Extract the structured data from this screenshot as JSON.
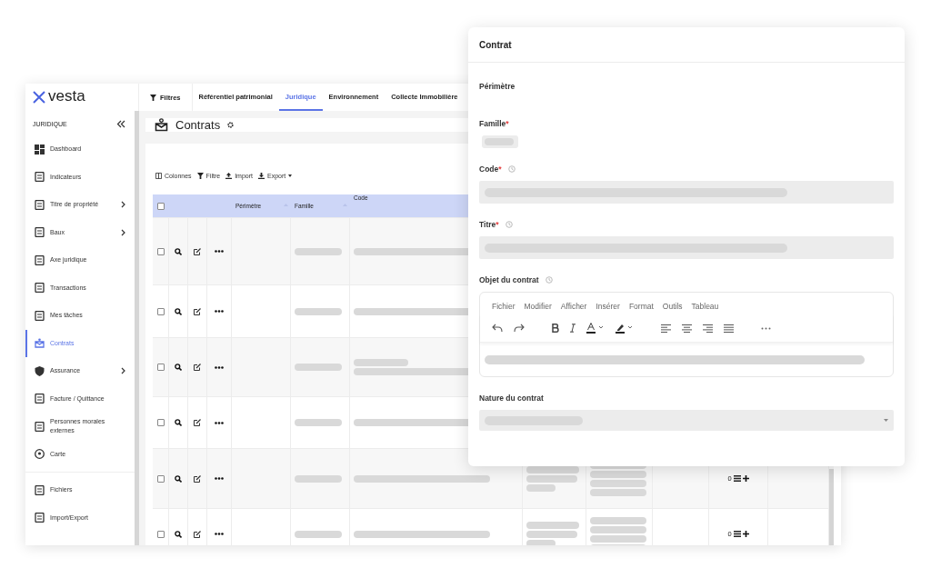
{
  "logo": {
    "text": "vesta"
  },
  "top_nav": {
    "filter_button": "Filtres",
    "tabs": [
      {
        "label": "Référentiel patrimonial",
        "selected": false
      },
      {
        "label": "Juridique",
        "selected": true
      },
      {
        "label": "Environnement",
        "selected": false
      },
      {
        "label": "Collecte Immobilière",
        "selected": false
      }
    ]
  },
  "sidebar": {
    "section": "JURIDIQUE",
    "groups": [
      [
        {
          "label": "Dashboard",
          "selected": false,
          "has_submenu": false
        },
        {
          "label": "Indicateurs",
          "selected": false,
          "has_submenu": false
        },
        {
          "label": "Titre de propriété",
          "selected": false,
          "has_submenu": true
        },
        {
          "label": "Baux",
          "selected": false,
          "has_submenu": true
        },
        {
          "label": "Axe juridique",
          "selected": false,
          "has_submenu": false
        },
        {
          "label": "Transactions",
          "selected": false,
          "has_submenu": false
        },
        {
          "label": "Mes tâches",
          "selected": false,
          "has_submenu": false
        },
        {
          "label": "Contrats",
          "selected": true,
          "has_submenu": false
        },
        {
          "label": "Assurance",
          "selected": false,
          "has_submenu": true
        },
        {
          "label": "Facture / Quittance",
          "selected": false,
          "has_submenu": false
        },
        {
          "label": "Personnes morales externes",
          "selected": false,
          "has_submenu": false
        },
        {
          "label": "Carte",
          "selected": false,
          "has_submenu": false
        }
      ],
      [
        {
          "label": "Fichiers",
          "selected": false,
          "has_submenu": false
        },
        {
          "label": "Import/Export",
          "selected": false,
          "has_submenu": false
        }
      ]
    ]
  },
  "page": {
    "title": "Contrats"
  },
  "table": {
    "toolbar": [
      {
        "label": "Colonnes",
        "kind": "columns"
      },
      {
        "label": "Filtre",
        "kind": "filter"
      },
      {
        "label": "Import",
        "kind": "import"
      },
      {
        "label": "Export",
        "kind": "export"
      }
    ],
    "select_all_checked": false,
    "columns": [
      "Périmètre",
      "Famille",
      "Code"
    ],
    "rows": [
      {
        "checked": false
      },
      {
        "checked": false
      },
      {
        "checked": false
      },
      {
        "checked": false
      },
      {
        "checked": false,
        "count": "0"
      },
      {
        "checked": false,
        "count": "0"
      }
    ]
  },
  "panel": {
    "title": "Contrat",
    "fields": [
      {
        "label": "Périmètre",
        "kind": "none",
        "history": false
      },
      {
        "label": "Famille",
        "required_mark": "*",
        "kind": "tag",
        "history": false
      },
      {
        "label": "Code",
        "required_mark": "*",
        "kind": "input",
        "history": true
      },
      {
        "label": "Titre",
        "required_mark": "*",
        "kind": "input",
        "history": true
      },
      {
        "label": "Objet du contrat",
        "kind": "editor",
        "history": true
      },
      {
        "label": "Nature du contrat",
        "kind": "select",
        "history": false
      }
    ],
    "editor_menu": [
      "Fichier",
      "Modifier",
      "Afficher",
      "Insérer",
      "Format",
      "Outils",
      "Tableau"
    ]
  }
}
